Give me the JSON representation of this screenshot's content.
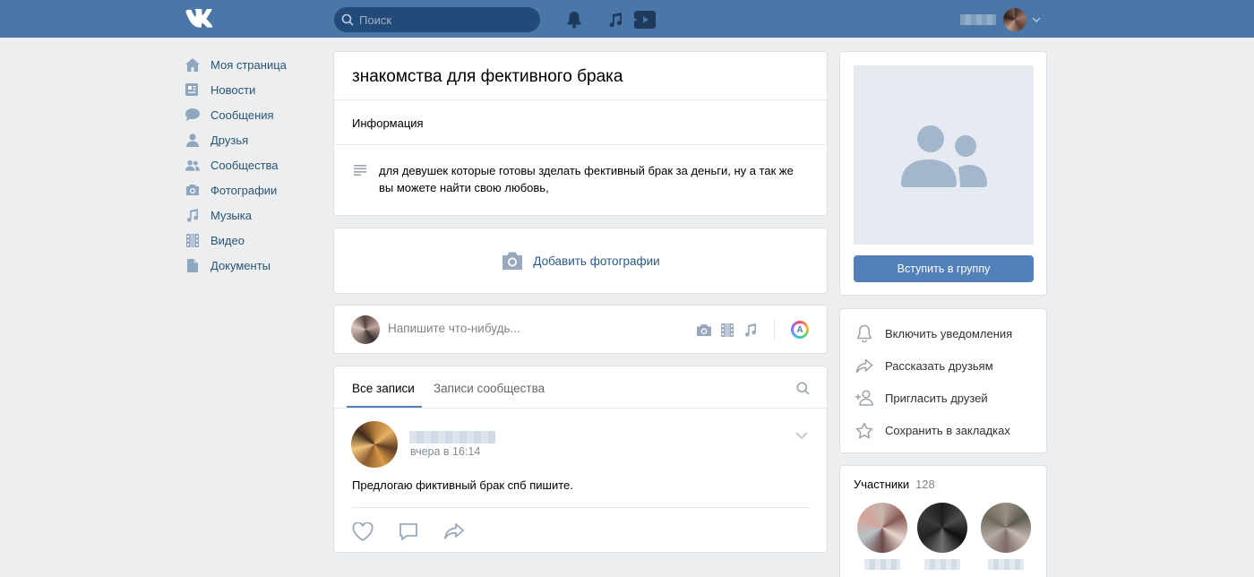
{
  "header": {
    "logo": "VK",
    "search_placeholder": "Поиск",
    "icons": [
      "bell-icon",
      "music-icon",
      "video-icon"
    ]
  },
  "nav": {
    "items": [
      {
        "label": "Моя страница",
        "icon": "home-icon"
      },
      {
        "label": "Новости",
        "icon": "news-icon"
      },
      {
        "label": "Сообщения",
        "icon": "messages-icon"
      },
      {
        "label": "Друзья",
        "icon": "friend-icon"
      },
      {
        "label": "Сообщества",
        "icon": "groups-icon"
      },
      {
        "label": "Фотографии",
        "icon": "camera-icon"
      },
      {
        "label": "Музыка",
        "icon": "music-icon"
      },
      {
        "label": "Видео",
        "icon": "film-icon"
      },
      {
        "label": "Документы",
        "icon": "document-icon"
      }
    ]
  },
  "group": {
    "title": "знакомства для фективного брака",
    "info_heading": "Информация",
    "description": "для девушек которые готовы зделать фективный брак за деньги, ну а так же вы можете найти свою любовь,",
    "add_photos": "Добавить фотографии"
  },
  "post_box": {
    "placeholder": "Напишите что-нибудь..."
  },
  "wall": {
    "tabs": [
      "Все записи",
      "Записи сообщества"
    ],
    "post": {
      "date": "вчера в 16:14",
      "text": "Предлогаю фиктивный брак спб пишите."
    }
  },
  "sidebar": {
    "join_button": "Вступить в группу",
    "actions": [
      {
        "label": "Включить уведомления",
        "icon": "bell-icon"
      },
      {
        "label": "Рассказать друзьям",
        "icon": "share-icon"
      },
      {
        "label": "Пригласить друзей",
        "icon": "add-user-icon"
      },
      {
        "label": "Сохранить в закладках",
        "icon": "star-icon"
      }
    ],
    "members_title": "Участники",
    "members_count": "128"
  },
  "colors": {
    "header": "#4a76a8",
    "accent": "#5181b8",
    "link": "#2a5885",
    "background": "#edeef0"
  }
}
